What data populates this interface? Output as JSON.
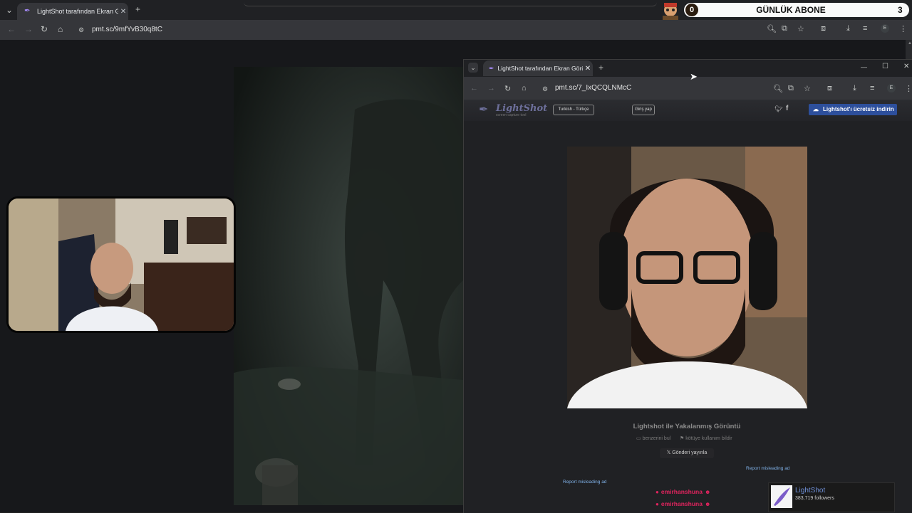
{
  "back_browser": {
    "tab_title": "LightShot tarafından Ekran Görü",
    "tab_list_icon": "chevron-down-icon",
    "new_tab": "+",
    "close": "✕",
    "url": "pmt.sc/9mfYvB30q8tC"
  },
  "subscriber_widget": {
    "left_count": "0",
    "label": "GÜNLÜK ABONE",
    "right_count": "3"
  },
  "front_browser": {
    "tab_title": "LightShot tarafından Ekran Görü",
    "new_tab": "+",
    "close": "✕",
    "url": "pmt.sc/7_IxQCQLNMcC",
    "window_controls": [
      "—",
      "☐",
      "✕"
    ]
  },
  "lightshot": {
    "logo": "LightShot",
    "logo_sub": "screen capture tool",
    "language": "Turkish - Türkçe",
    "login": "Giriş yap",
    "download": "Lightshot'ı ücretsiz indirin",
    "caption": "Lightshot ile Yakalanmış Görüntü",
    "find_similar": "benzerini bul",
    "report_abuse": "kötüye kullanım bildir",
    "share": "𝕏  Gönderi yayınla",
    "report_ad_1": "Report misleading ad",
    "report_ad_2": "Report misleading ad",
    "chat": [
      "emirhanshuna",
      "emirhanshuna"
    ],
    "card": {
      "name": "LightShot",
      "followers": "383,719 followers"
    }
  }
}
